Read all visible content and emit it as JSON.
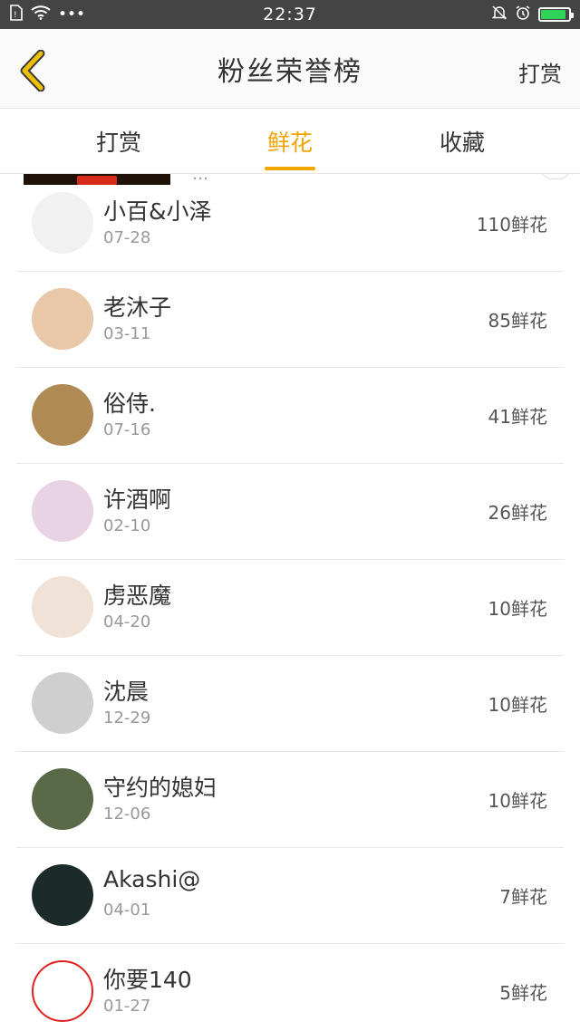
{
  "status_bar": {
    "time": "22:37",
    "dots": "•••",
    "battery_level": 0.9,
    "battery_color": "#2fd35a",
    "left_icons": [
      "sim-icon",
      "wifi-icon"
    ],
    "right_icons": [
      "mute-bell-icon",
      "alarm-icon",
      "battery-icon"
    ]
  },
  "nav": {
    "title": "粉丝荣誉榜",
    "right_label": "打赏",
    "back_icon": "chevron-left-icon",
    "back_color": "#f0c000"
  },
  "tabs": [
    {
      "label": "打赏",
      "active": false
    },
    {
      "label": "鲜花",
      "active": true
    },
    {
      "label": "收藏",
      "active": false
    }
  ],
  "accent_color": "#f0a500",
  "rows": [
    {
      "name": "小百&小泽",
      "date": "07-28",
      "amount": "110鲜花",
      "avatar_color": "#f1f1f1"
    },
    {
      "name": "老沐子",
      "date": "03-11",
      "amount": "85鲜花",
      "avatar_color": "#e9c7a9"
    },
    {
      "name": "俗侍.",
      "date": "07-16",
      "amount": "41鲜花",
      "avatar_color": "#b08a55"
    },
    {
      "name": "许酒啊",
      "date": "02-10",
      "amount": "26鲜花",
      "avatar_color": "#e7d3e4"
    },
    {
      "name": "虏恶魔",
      "date": "04-20",
      "amount": "10鲜花",
      "avatar_color": "#f0e2d6"
    },
    {
      "name": "沈晨",
      "date": "12-29",
      "amount": "10鲜花",
      "avatar_color": "#cfcfcf"
    },
    {
      "name": "守约的媳妇",
      "date": "12-06",
      "amount": "10鲜花",
      "avatar_color": "#5a6a48"
    },
    {
      "name": "Akashi@",
      "date": "04-01",
      "amount": "7鲜花",
      "avatar_color": "#1d2a2a"
    },
    {
      "name": "你要140",
      "date": "01-27",
      "amount": "5鲜花",
      "avatar_color": "#ffffff"
    }
  ]
}
